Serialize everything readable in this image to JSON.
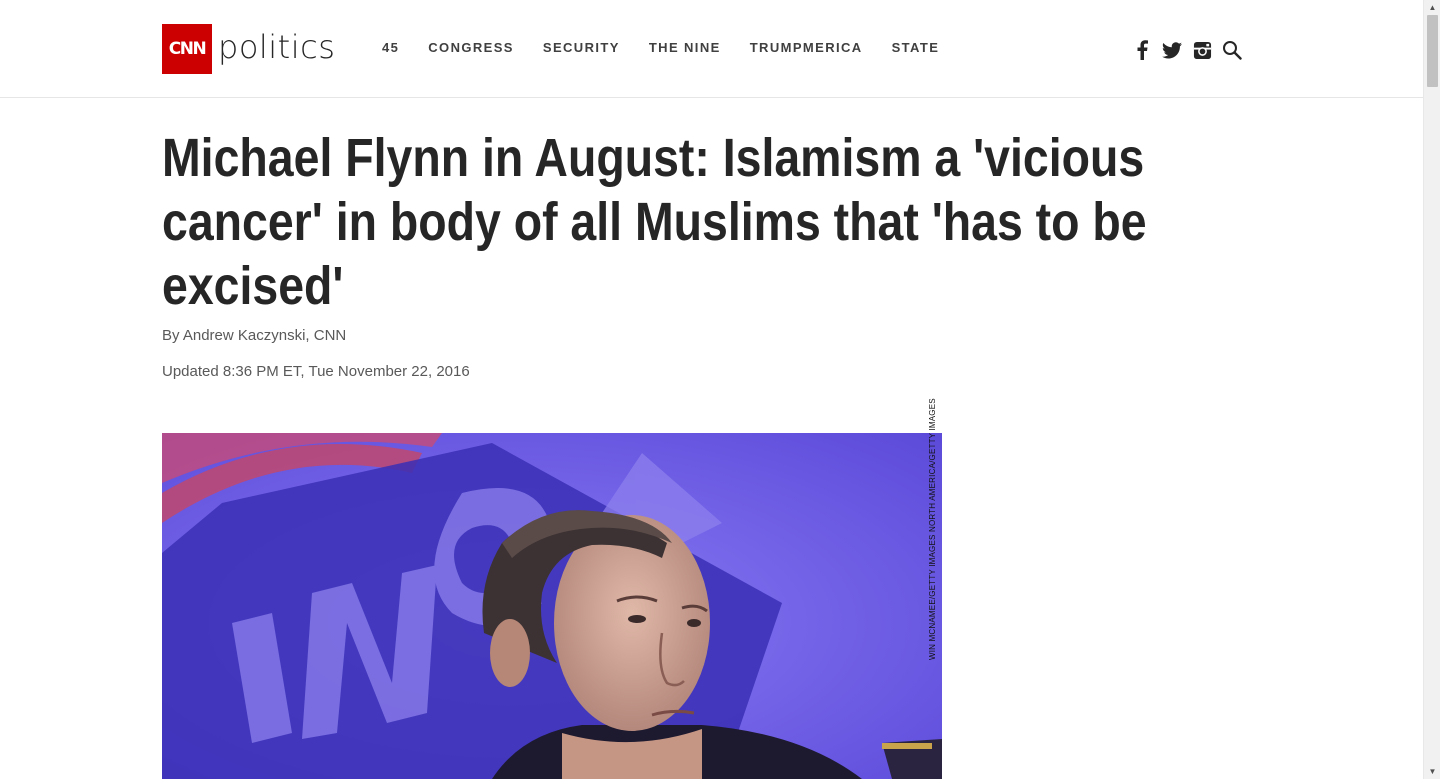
{
  "header": {
    "logo": {
      "brand": "CNN",
      "section": "politics"
    },
    "nav": [
      {
        "label": "45"
      },
      {
        "label": "CONGRESS"
      },
      {
        "label": "SECURITY"
      },
      {
        "label": "THE NINE"
      },
      {
        "label": "TRUMPMERICA"
      },
      {
        "label": "STATE"
      }
    ],
    "social_icons": [
      "facebook-icon",
      "twitter-icon",
      "instagram-icon",
      "search-icon"
    ]
  },
  "article": {
    "headline": "Michael Flynn in August: Islamism a 'vicious cancer' in body of all Muslims that 'has to be excised'",
    "byline_prefix": "By ",
    "author": "Andrew Kaczynski",
    "byline_suffix": ", CNN",
    "updated": "Updated 8:36 PM ET, Tue November 22, 2016",
    "image_credit": "WIN MCNAMEE/GETTY IMAGES NORTH AMERICA/GETTY IMAGES"
  },
  "colors": {
    "brand_red": "#cc0000",
    "text": "#262626",
    "muted": "#595959",
    "photo_background": "#6b58e8"
  }
}
